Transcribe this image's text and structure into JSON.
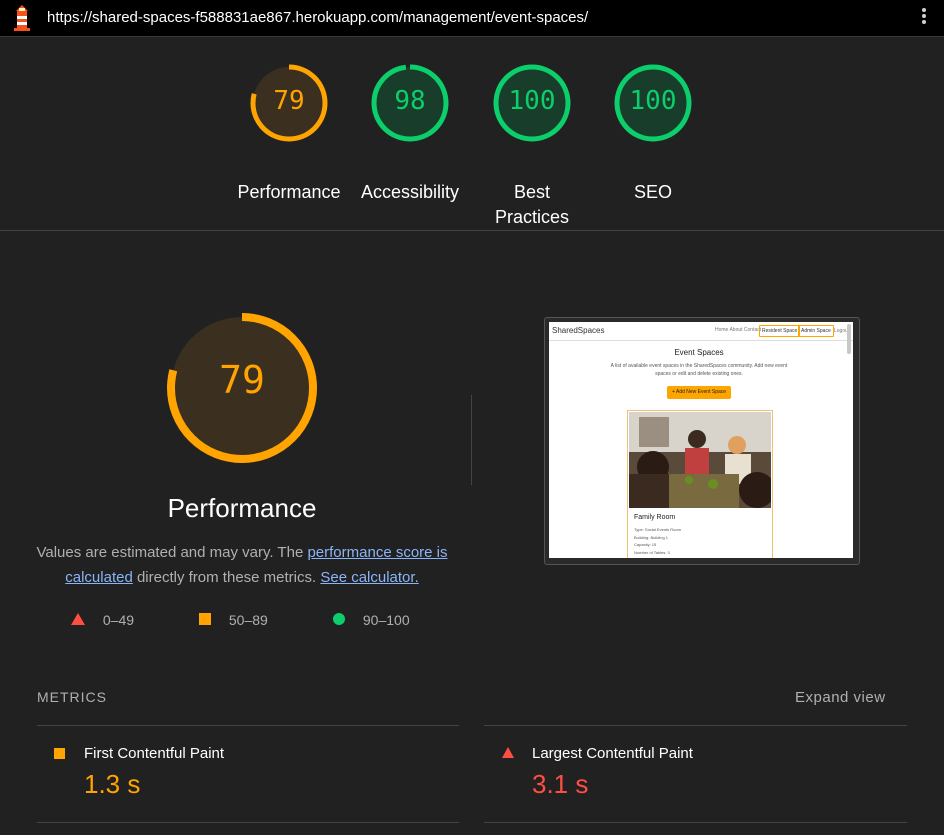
{
  "url_bar": {
    "url": "https://shared-spaces-f588831ae867.herokuapp.com/management/event-spaces/"
  },
  "scores": [
    {
      "label": "Performance",
      "value": "79",
      "color": "#ffa400"
    },
    {
      "label": "Accessibility",
      "value": "98",
      "color": "#0cce6b"
    },
    {
      "label": "Best Practices",
      "value": "100",
      "color": "#0cce6b"
    },
    {
      "label": "SEO",
      "value": "100",
      "color": "#0cce6b"
    }
  ],
  "performance": {
    "score": "79",
    "score_fraction": 0.79,
    "title": "Performance",
    "desc_before": "Values are estimated and may vary. The ",
    "link_score": "performance score is calculated",
    "desc_middle": " directly from these metrics. ",
    "link_calc": "See calculator."
  },
  "legend": [
    {
      "range": "0–49",
      "icon": "triangle-icon",
      "color": "#ff4e42"
    },
    {
      "range": "50–89",
      "icon": "square-icon",
      "color": "#ffa400"
    },
    {
      "range": "90–100",
      "icon": "circle-icon",
      "color": "#0cce6b"
    }
  ],
  "thumbnail": {
    "brand": "SharedSpaces",
    "nav_links": "Home   About   Contact",
    "btn_resident": "Resident Space",
    "btn_admin": "Admin Space",
    "logout": "Logout",
    "heading": "Event Spaces",
    "subtext": "A list of available event spaces in the SharedSpaces community. Add new event spaces or edit and delete existing ones.",
    "add_button": "+ Add New Event Space",
    "card_title": "Family Room",
    "card_meta": [
      "Type: Social Events Room",
      "Building: Building 1",
      "Capacity: 15",
      "Number of Tables: 3"
    ]
  },
  "metrics": {
    "section_label": "METRICS",
    "expand_label": "Expand view",
    "items": [
      {
        "name": "First Contentful Paint",
        "value": "1.3 s",
        "color": "#ffa400",
        "icon": "square-icon"
      },
      {
        "name": "Largest Contentful Paint",
        "value": "3.1 s",
        "color": "#ff4e42",
        "icon": "triangle-icon"
      }
    ]
  }
}
